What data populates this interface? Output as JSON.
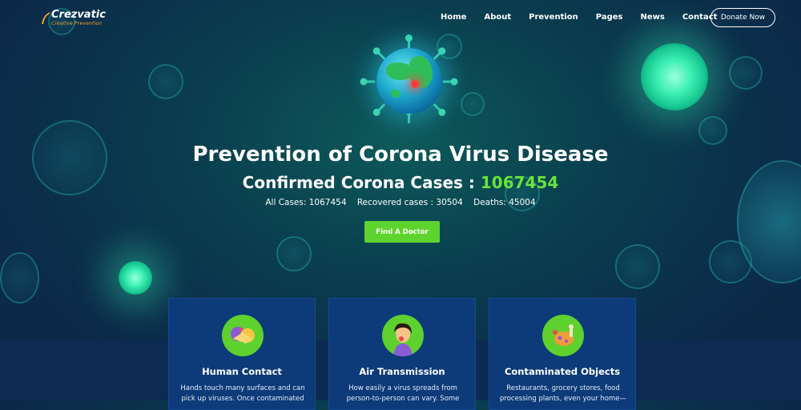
{
  "brand": {
    "name": "Crezvatic",
    "tagline": "Creative Prevention"
  },
  "nav": {
    "items": [
      "Home",
      "About",
      "Prevention",
      "Pages",
      "News",
      "Contact"
    ],
    "donate_label": "Donate Now"
  },
  "hero": {
    "title": "Prevention of Corona Virus Disease",
    "subtitle_prefix": "Confirmed Corona Cases : ",
    "confirmed_count": "1067454",
    "stats": {
      "all_cases": "All Cases: 1067454",
      "recovered": "Recovered cases : 30504",
      "deaths": "Deaths: 45004"
    },
    "cta_label": "Find A Doctor"
  },
  "cards": [
    {
      "title": "Human Contact",
      "text": "Hands touch many surfaces and can pick up viruses. Once contaminated",
      "icon": "handshake-icon"
    },
    {
      "title": "Air Transmission",
      "text": "How easily a virus spreads from person-to-person can vary. Some",
      "icon": "coughing-person-icon"
    },
    {
      "title": "Contaminated Objects",
      "text": "Restaurants, grocery stores, food processing plants, even your home—",
      "icon": "food-objects-icon"
    }
  ],
  "colors": {
    "accent": "#5dd42e",
    "count": "#68e43b",
    "card_bg": "#0d3a78",
    "logo_orange": "#f6a623"
  }
}
